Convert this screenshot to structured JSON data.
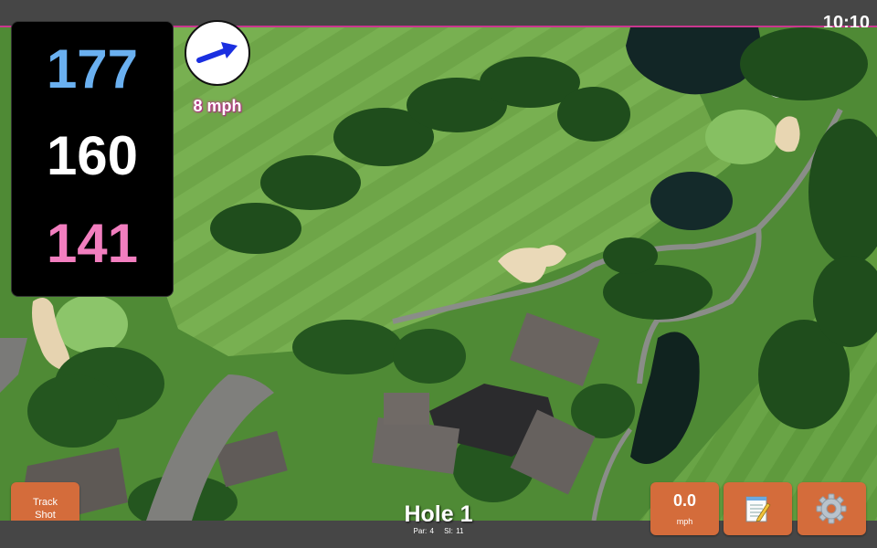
{
  "status_bar": {
    "time": "10:10"
  },
  "distances": {
    "back": "177",
    "middle": "160",
    "front": "141"
  },
  "wind": {
    "speed": "8 mph",
    "direction": "east-northeast"
  },
  "buttons": {
    "track_shot_line1": "Track",
    "track_shot_line2": "Shot",
    "speed_value": "0.0",
    "speed_unit": "mph",
    "notes_icon": "notepad-icon",
    "settings_icon": "gear-icon"
  },
  "hole": {
    "title": "Hole 1",
    "par": "Par: 4",
    "si": "SI: 11"
  },
  "colors": {
    "back_distance": "#6ab0f0",
    "middle_distance": "#ffffff",
    "front_distance": "#f27ebf",
    "button": "#d46c3b",
    "accent_line": "#c9378f"
  }
}
